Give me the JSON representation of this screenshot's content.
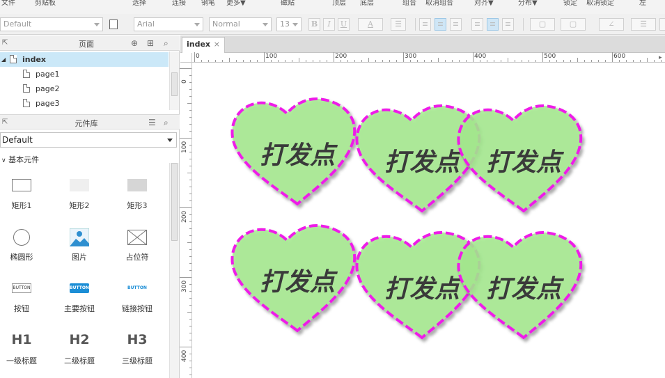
{
  "ribbon": {
    "items": [
      "文件",
      "剪贴板",
      "选择",
      "连接",
      "钢笔",
      "更多▼",
      "磁贴",
      "顶层",
      "底层",
      "组合",
      "取消组合",
      "对齐▼",
      "分布▼",
      "锁定",
      "取消锁定",
      "左"
    ]
  },
  "toolbar": {
    "style_select": "Default",
    "font_select": "Arial",
    "weight_select": "Normal",
    "size_select": "13",
    "bold": "B",
    "italic": "I",
    "underline": "U",
    "font_color": "A"
  },
  "pages_panel": {
    "title": "页面",
    "root": "index",
    "pages": [
      "page1",
      "page2",
      "page3"
    ]
  },
  "library_panel": {
    "title": "元件库",
    "selected_library": "Default",
    "category": "基本元件",
    "widgets": [
      {
        "label": "矩形1",
        "icon": "rectangle-icon"
      },
      {
        "label": "矩形2",
        "icon": "rectangle-light-icon"
      },
      {
        "label": "矩形3",
        "icon": "rectangle-gray-icon"
      },
      {
        "label": "椭圆形",
        "icon": "ellipse-icon"
      },
      {
        "label": "图片",
        "icon": "image-icon"
      },
      {
        "label": "占位符",
        "icon": "placeholder-icon"
      },
      {
        "label": "按钮",
        "icon": "button-icon",
        "text": "BUTTON"
      },
      {
        "label": "主要按钮",
        "icon": "primary-button-icon",
        "text": "BUTTON"
      },
      {
        "label": "链接按钮",
        "icon": "link-button-icon",
        "text": "BUTTON"
      },
      {
        "label": "一级标题",
        "icon": "h1-icon",
        "text": "H1"
      },
      {
        "label": "二级标题",
        "icon": "h2-icon",
        "text": "H2"
      },
      {
        "label": "三级标题",
        "icon": "h3-icon",
        "text": "H3"
      }
    ]
  },
  "canvas": {
    "tab": "index",
    "tab_close": "×",
    "ruler_h": [
      "0",
      "100",
      "200",
      "300",
      "400",
      "500",
      "600"
    ],
    "ruler_v": [
      "0",
      "100",
      "200",
      "300",
      "400"
    ],
    "heart_label": "打发点",
    "colors": {
      "heart_fill": "#a6eb8f",
      "heart_stroke": "#ee1be8",
      "overlap_fill": "#6fe04f",
      "text": "#3a3a3a"
    }
  }
}
